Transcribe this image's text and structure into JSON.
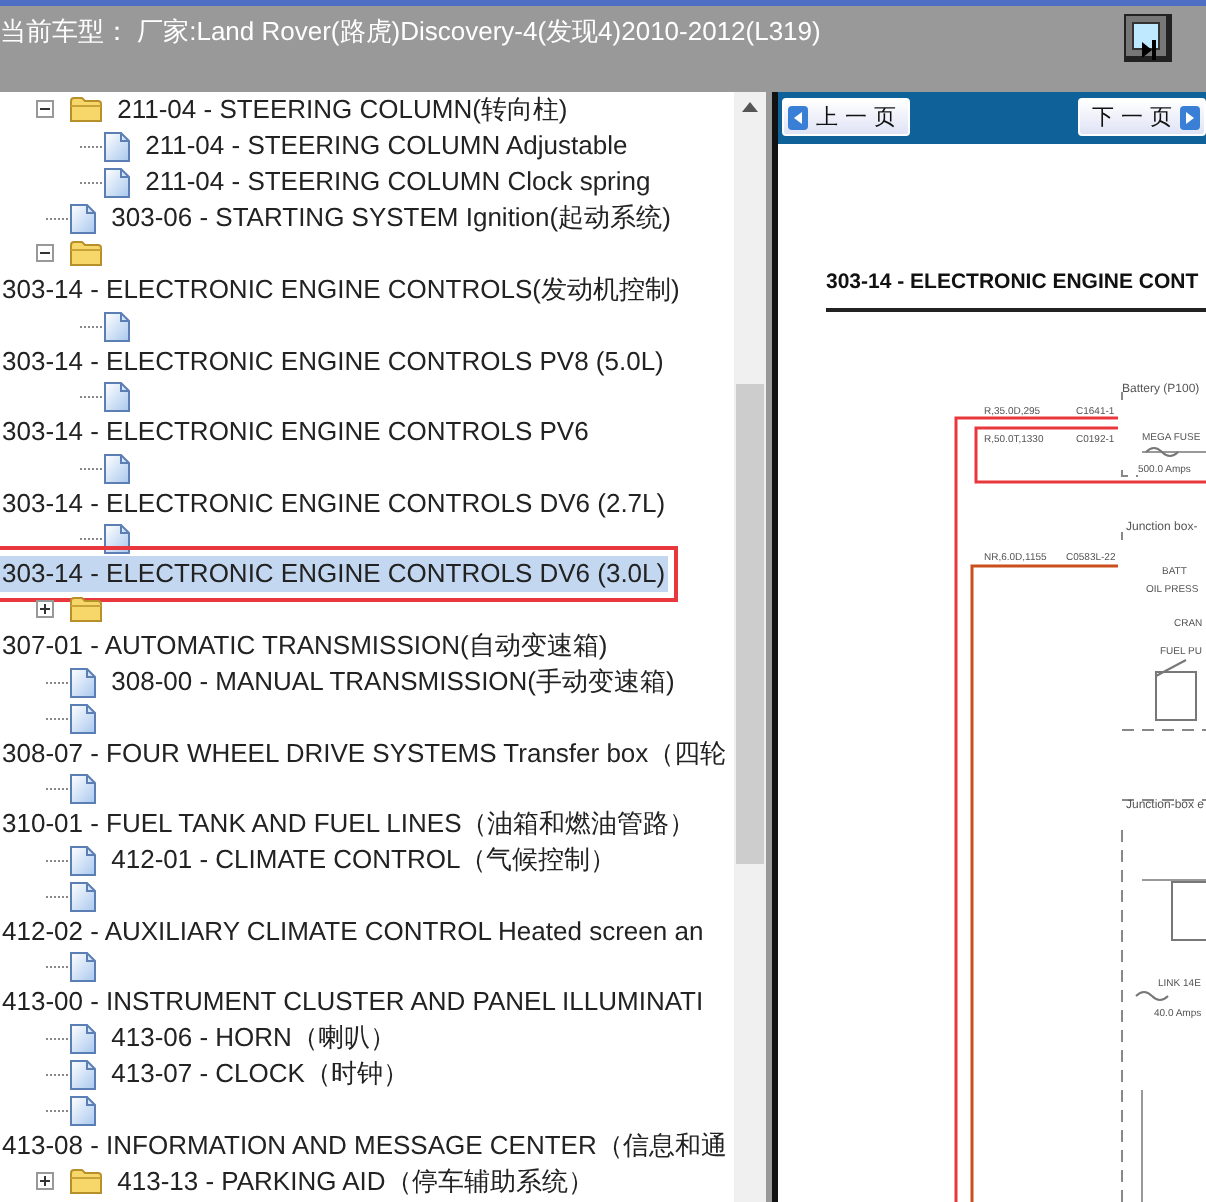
{
  "header": {
    "title": "当前车型： 厂家:Land Rover(路虎)Discovery-4(发现4)2010-2012(L319)"
  },
  "tree": [
    {
      "kind": "folder",
      "label": "211-04 - STEERING COLUMN(转向柱)",
      "expanded": true,
      "children": [
        {
          "kind": "doc",
          "label": "211-04 - STEERING COLUMN Adjustable",
          "selected": false
        },
        {
          "kind": "doc",
          "label": "211-04 - STEERING COLUMN Clock spring",
          "selected": false
        }
      ]
    },
    {
      "kind": "doc",
      "label": "303-06 - STARTING SYSTEM Ignition(起动系统)",
      "selected": false
    },
    {
      "kind": "folder",
      "label": "303-14 - ELECTRONIC ENGINE CONTROLS(发动机控制)",
      "expanded": true,
      "children": [
        {
          "kind": "doc",
          "label": "303-14 - ELECTRONIC ENGINE CONTROLS PV8 (5.0L)",
          "selected": false
        },
        {
          "kind": "doc",
          "label": "303-14 - ELECTRONIC ENGINE CONTROLS PV6",
          "selected": false
        },
        {
          "kind": "doc",
          "label": "303-14 - ELECTRONIC ENGINE CONTROLS DV6 (2.7L)",
          "selected": false
        },
        {
          "kind": "doc",
          "label": "303-14 - ELECTRONIC ENGINE CONTROLS DV6 (3.0L)",
          "selected": true
        }
      ]
    },
    {
      "kind": "folder",
      "label": "307-01 - AUTOMATIC TRANSMISSION(自动变速箱)",
      "expanded": false
    },
    {
      "kind": "doc",
      "label": "308-00 - MANUAL TRANSMISSION(手动变速箱)",
      "selected": false
    },
    {
      "kind": "doc",
      "label": "308-07 - FOUR WHEEL DRIVE SYSTEMS Transfer box（四轮",
      "selected": false
    },
    {
      "kind": "doc",
      "label": "310-01 - FUEL TANK AND FUEL LINES（油箱和燃油管路）",
      "selected": false
    },
    {
      "kind": "doc",
      "label": "412-01 - CLIMATE CONTROL（气候控制）",
      "selected": false
    },
    {
      "kind": "doc",
      "label": "412-02 - AUXILIARY CLIMATE CONTROL Heated screen an",
      "selected": false
    },
    {
      "kind": "doc",
      "label": "413-00 - INSTRUMENT CLUSTER AND PANEL ILLUMINATI",
      "selected": false
    },
    {
      "kind": "doc",
      "label": "413-06 - HORN（喇叭）",
      "selected": false
    },
    {
      "kind": "doc",
      "label": "413-07 - CLOCK（时钟）",
      "selected": false
    },
    {
      "kind": "doc",
      "label": "413-08 - INFORMATION AND MESSAGE CENTER（信息和通",
      "selected": false
    },
    {
      "kind": "folder",
      "label": "413-13 - PARKING AID（停车辅助系统）",
      "expanded": false
    }
  ],
  "viewer": {
    "buttons": [
      {
        "kind": "prev",
        "label": "上 一 页"
      },
      {
        "kind": "next",
        "label": "下 一 页"
      }
    ],
    "document": {
      "title": "303-14 - ELECTRONIC ENGINE CONT",
      "labels": [
        "Battery (P100)",
        "R,35.0D,295",
        "C1641-1",
        "R,50.0T,1330",
        "C0192-1",
        "MEGA FUSE",
        "500.0 Amps",
        "Junction box-",
        "NR,6.0D,1155",
        "C0583L-22",
        "BATT",
        "OIL PRESS",
        "CRAN",
        "FUEL PU",
        "Junction-box e",
        "LINK 14E",
        "40.0 Amps"
      ]
    }
  }
}
